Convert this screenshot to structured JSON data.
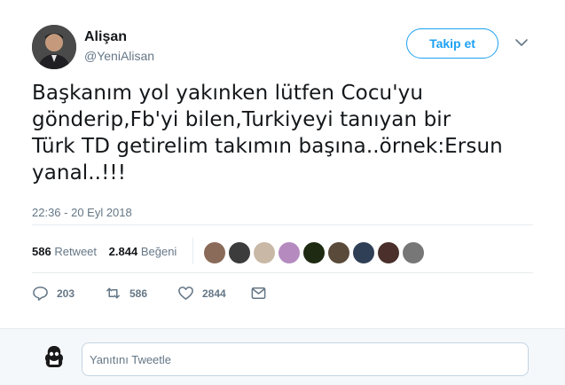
{
  "header": {
    "display_name": "Alişan",
    "handle": "@YeniAlisan",
    "follow_label": "Takip et",
    "menu_icon": "chevron-down-icon"
  },
  "tweet": {
    "text": "Başkanım yol yakınken lütfen Cocu'yu\ngönderip,Fb'yi bilen,Turkiyeyi  tanıyan bir\nTürk TD getirelim takımın başına..örnek:Ersun\nyanal..!!!",
    "timestamp": "22:36 - 20 Eyl 2018"
  },
  "stats": {
    "retweet_count": "586",
    "retweet_label": "Retweet",
    "like_count": "2.844",
    "like_label": "Beğeni",
    "liker_colors": [
      "#8a6a58",
      "#3c3c3c",
      "#c9b8a6",
      "#b58bbf",
      "#1e2a12",
      "#5a4a3a",
      "#2f3f55",
      "#4a2f2a",
      "#777777"
    ]
  },
  "actions": {
    "reply_count": "203",
    "retweet_count": "586",
    "like_count": "2844"
  },
  "reply": {
    "placeholder": "Yanıtını Tweetle"
  },
  "colors": {
    "accent": "#1da1f2",
    "muted": "#657786",
    "text": "#14171a"
  }
}
